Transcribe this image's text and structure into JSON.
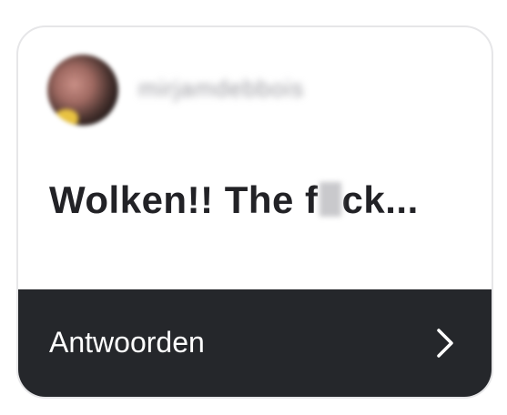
{
  "card": {
    "username": "mirjamdebbois",
    "message_before": "Wolken!! The f",
    "message_after": "ck...",
    "reply_label": "Antwoorden"
  },
  "icons": {
    "avatar": "profile-picture",
    "chevron": "chevron-right-icon"
  },
  "colors": {
    "card_border": "#e6e6e8",
    "reply_bar_bg": "#25272b",
    "message_text": "#222226",
    "reply_text": "#ffffff"
  }
}
